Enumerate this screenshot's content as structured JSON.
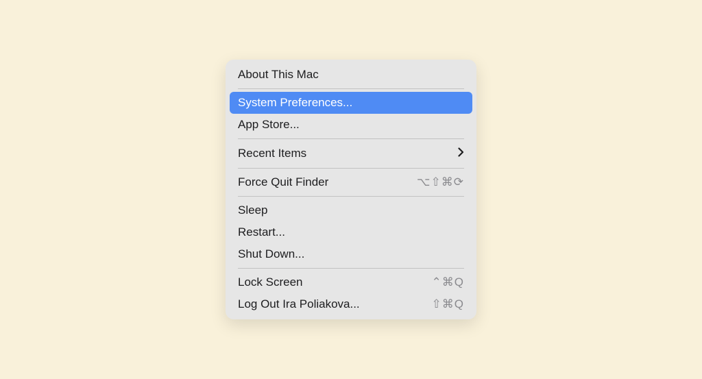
{
  "menu": {
    "items": [
      {
        "label": "About This Mac",
        "shortcut": "",
        "submenu": false,
        "highlighted": false
      },
      {
        "separator": true
      },
      {
        "label": "System Preferences...",
        "shortcut": "",
        "submenu": false,
        "highlighted": true
      },
      {
        "label": "App Store...",
        "shortcut": "",
        "submenu": false,
        "highlighted": false
      },
      {
        "separator": true
      },
      {
        "label": "Recent Items",
        "shortcut": "",
        "submenu": true,
        "highlighted": false
      },
      {
        "separator": true
      },
      {
        "label": "Force Quit Finder",
        "shortcut": "⌥⇧⌘⟳",
        "submenu": false,
        "highlighted": false
      },
      {
        "separator": true
      },
      {
        "label": "Sleep",
        "shortcut": "",
        "submenu": false,
        "highlighted": false
      },
      {
        "label": "Restart...",
        "shortcut": "",
        "submenu": false,
        "highlighted": false
      },
      {
        "label": "Shut Down...",
        "shortcut": "",
        "submenu": false,
        "highlighted": false
      },
      {
        "separator": true
      },
      {
        "label": "Lock Screen",
        "shortcut": "⌃⌘Q",
        "submenu": false,
        "highlighted": false
      },
      {
        "label": "Log Out Ira Poliakova...",
        "shortcut": "⇧⌘Q",
        "submenu": false,
        "highlighted": false
      }
    ]
  }
}
